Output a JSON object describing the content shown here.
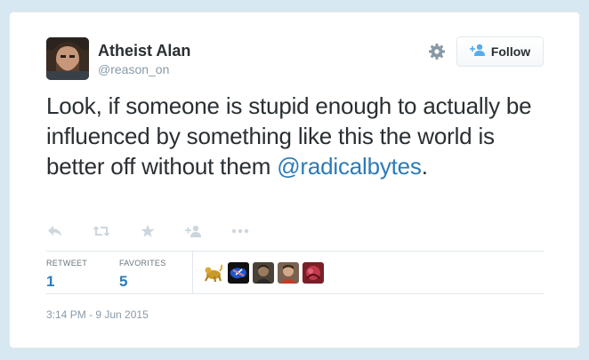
{
  "author": {
    "name": "Atheist Alan",
    "handle": "@reason_on"
  },
  "follow_button": {
    "label": "Follow"
  },
  "tweet": {
    "text_part1": "Look, if someone is stupid enough to actually be influenced by something like this the world is better off without them ",
    "mention": "@radicalbytes",
    "text_part2": "."
  },
  "actions": [
    "reply-icon",
    "retweet-icon",
    "favorite-icon",
    "follow-small-icon",
    "more-icon"
  ],
  "stats": {
    "retweet_label": "RETWEET",
    "retweet_count": "1",
    "favorites_label": "FAVORITES",
    "favorites_count": "5"
  },
  "timestamp": "3:14 PM - 9 Jun 2015",
  "colors": {
    "link": "#2b7bb9",
    "text": "#292f33",
    "muted": "#8899a6",
    "background": "#d8e8f2"
  }
}
